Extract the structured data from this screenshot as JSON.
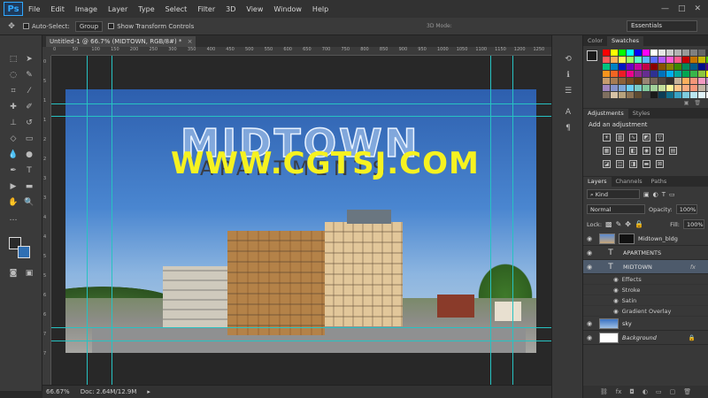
{
  "app": {
    "logo": "Ps"
  },
  "menu": [
    "File",
    "Edit",
    "Image",
    "Layer",
    "Type",
    "Select",
    "Filter",
    "3D",
    "View",
    "Window",
    "Help"
  ],
  "window_controls": [
    "—",
    "□",
    "✕"
  ],
  "options": {
    "auto_select_label": "Auto-Select:",
    "auto_select_value": "Group",
    "transform_label": "Show Transform Controls",
    "mode_3d_label": "3D Mode:",
    "workspace": "Essentials"
  },
  "document": {
    "tab_title": "Untitled-1 @ 66.7% (MIDTOWN, RGB/8#) *",
    "zoom": "66.67%",
    "doc_size": "Doc: 2.64M/12.9M"
  },
  "ruler_marks": [
    "0",
    "50",
    "100",
    "150",
    "200",
    "250",
    "300",
    "350",
    "400",
    "450",
    "500",
    "550",
    "600",
    "650",
    "700",
    "750",
    "800",
    "850",
    "900",
    "950",
    "1000",
    "1050",
    "1100",
    "1150",
    "1200",
    "1250"
  ],
  "ruler_v_marks": [
    "0",
    "5",
    "1",
    "1",
    "2",
    "2",
    "3",
    "3",
    "4",
    "4",
    "5",
    "5",
    "6",
    "6",
    "7",
    "7"
  ],
  "canvas": {
    "title": "MIDTOWN",
    "subtitle": "APARTMENTS",
    "watermark": "WWW.CGTSJ.COM"
  },
  "panels": {
    "swatches_tabs": [
      "Color",
      "Swatches"
    ],
    "adjust_tabs": [
      "Adjustments",
      "Styles"
    ],
    "adjust_title": "Add an adjustment",
    "layers_tabs": [
      "Layers",
      "Channels",
      "Paths"
    ],
    "kind_label": "Kind",
    "blend_mode": "Normal",
    "opacity_label": "Opacity:",
    "opacity_value": "100%",
    "lock_label": "Lock:",
    "fill_label": "Fill:",
    "fill_value": "100%"
  },
  "layers": [
    {
      "name": "Midtown_bldg",
      "type": "image",
      "selected": false
    },
    {
      "name": "APARTMENTS",
      "type": "text",
      "selected": false
    },
    {
      "name": "MIDTOWN",
      "type": "text",
      "selected": true,
      "fx": "fx"
    },
    {
      "name": "sky",
      "type": "image",
      "selected": false
    },
    {
      "name": "Background",
      "type": "image",
      "selected": false
    }
  ],
  "effects_label": "Effects",
  "effects": [
    "Stroke",
    "Satin",
    "Gradient Overlay"
  ],
  "swatch_colors": [
    "#ff0000",
    "#ffff00",
    "#00ff00",
    "#00ffff",
    "#0000ff",
    "#ff00ff",
    "#ffffff",
    "#e6e6e6",
    "#cccccc",
    "#b3b3b3",
    "#999999",
    "#808080",
    "#666666",
    "#333333",
    "#ff5a5a",
    "#ffae5a",
    "#fff55a",
    "#9cff5a",
    "#5affc6",
    "#5ab6ff",
    "#5a6dff",
    "#b05aff",
    "#ff5ad6",
    "#ff5a8c",
    "#c40000",
    "#c47400",
    "#c4b700",
    "#54c400",
    "#00c47f",
    "#0082c4",
    "#0015c4",
    "#6c00c4",
    "#c400a0",
    "#c40047",
    "#8a0000",
    "#8a5200",
    "#8a8100",
    "#3b8a00",
    "#008a59",
    "#005c8a",
    "#000f8a",
    "#4c008a",
    "#f7941d",
    "#f26522",
    "#ed1c24",
    "#ec008c",
    "#92278f",
    "#662d91",
    "#2e3192",
    "#0072bc",
    "#00aeef",
    "#00a99d",
    "#00a651",
    "#39b54a",
    "#8dc63f",
    "#fff200",
    "#c69c6d",
    "#a67c52",
    "#8c6239",
    "#754c24",
    "#603913",
    "#998675",
    "#736357",
    "#534741",
    "#362f2d",
    "#c7b299",
    "#fbaf5d",
    "#f69679",
    "#f49ac1",
    "#bd8cbf",
    "#a186be",
    "#8493ca",
    "#7da7d9",
    "#6dcff6",
    "#7accc8",
    "#82ca9c",
    "#a3d39c",
    "#c4df9b",
    "#fff79a",
    "#fdc68a",
    "#f9ad81",
    "#f7977a",
    "#c2b4a3",
    "#aaaaaa",
    "#7f6f5f",
    "#d5c1a5",
    "#b7a27d",
    "#8b7355",
    "#5f4b32",
    "#3d3d3d",
    "#1a1a1a",
    "#0d3d56",
    "#0f6e8c",
    "#3aa3c4",
    "#7ecbdd",
    "#b9e4ee",
    "#e0f2f7",
    "#f0f0f0"
  ],
  "footer_icons": [
    "⛓",
    "fx",
    "◘",
    "◐",
    "▭",
    "▢",
    "🗑"
  ]
}
